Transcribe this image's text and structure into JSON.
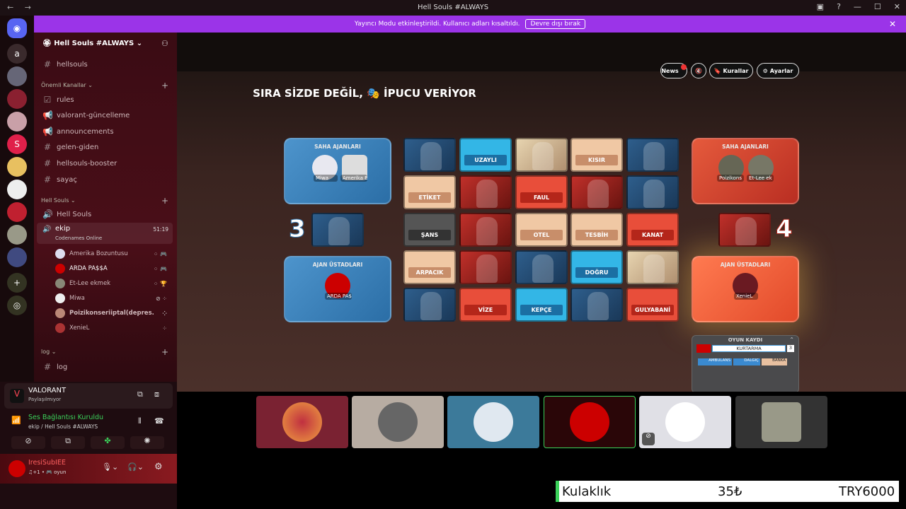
{
  "window": {
    "title": "Hell Souls #ALWAYS",
    "nav": "← →"
  },
  "banner": {
    "text": "Yayıncı Modu etkinleştirildi. Kullanıcı adları kısaltıldı.",
    "button": "Devre dışı bırak",
    "close": "✕"
  },
  "servers": [
    "a"
  ],
  "sidebar": {
    "server_name": "Hell Souls #ALWAYS",
    "top_channel": "hellsouls",
    "categories": [
      {
        "name": "Önemli Kanallar",
        "channels": [
          "rules",
          "valorant-güncelleme",
          "announcements",
          "gelen-giden",
          "hellsouls-booster",
          "sayaç"
        ]
      },
      {
        "name": "Hell Souls",
        "channels": [
          "Hell Souls"
        ]
      },
      {
        "name": "log",
        "channels": [
          "log"
        ]
      }
    ],
    "voice_channel": {
      "name": "ekip",
      "timer": "51:19",
      "activity": "Codenames Online"
    },
    "voice_users": [
      "Amerika Bozuntusu",
      "ARDA PA$$A",
      "Et-Lee ekmek",
      "Miwa",
      "Poizikonseriiptal(depres...",
      "XenieL"
    ]
  },
  "activity": {
    "game": "VALORANT",
    "status": "Paylaşılmıyor"
  },
  "voice": {
    "status": "Ses Bağlantısı Kuruldu",
    "location": "ekip / Hell Souls #ALWAYS"
  },
  "user": {
    "name": "IresiSubIEE",
    "status": "♫+1 • 🎮 oyun"
  },
  "game": {
    "buttons": {
      "news": "News",
      "rules": "Kurallar",
      "settings": "Ayarlar"
    },
    "turn_text": "SIRA SİZDE DEĞİL, 🎭 İPUCU VERİYOR",
    "blue_team": {
      "agents_title": "SAHA AJANLARI",
      "agents": [
        "Miwa",
        "Amerika B"
      ],
      "masters_title": "AJAN ÜSTADLARI",
      "masters": [
        "ARDA PA$"
      ],
      "score": "3"
    },
    "red_team": {
      "agents_title": "SAHA AJANLARI",
      "agents": [
        "Poizikons",
        "Et-Lee ek"
      ],
      "masters_title": "AJAN ÜSTADLARI",
      "masters": [
        "XenieL"
      ],
      "score": "4"
    },
    "board": [
      {
        "word": "",
        "type": "ablue"
      },
      {
        "word": "UZAYLI",
        "type": "blue"
      },
      {
        "word": "",
        "type": "abeige"
      },
      {
        "word": "KISIR",
        "type": "beige"
      },
      {
        "word": "",
        "type": "ablue"
      },
      {
        "word": "ETİKET",
        "type": "beige"
      },
      {
        "word": "",
        "type": "ared"
      },
      {
        "word": "FAUL",
        "type": "red"
      },
      {
        "word": "",
        "type": "ared"
      },
      {
        "word": "",
        "type": "ablue"
      },
      {
        "word": "ŞANS",
        "type": "gray"
      },
      {
        "word": "",
        "type": "ared"
      },
      {
        "word": "OTEL",
        "type": "beige"
      },
      {
        "word": "TESBİH",
        "type": "beige"
      },
      {
        "word": "KANAT",
        "type": "red"
      },
      {
        "word": "ARPACIK",
        "type": "beige"
      },
      {
        "word": "",
        "type": "ared"
      },
      {
        "word": "",
        "type": "ablue"
      },
      {
        "word": "DOĞRU",
        "type": "blue"
      },
      {
        "word": "",
        "type": "abeige"
      },
      {
        "word": "",
        "type": "ablue"
      },
      {
        "word": "VİZE",
        "type": "red"
      },
      {
        "word": "KEPÇE",
        "type": "blue"
      },
      {
        "word": "",
        "type": "ablue"
      },
      {
        "word": "GULYABANİ",
        "type": "red"
      }
    ],
    "log": {
      "title": "OYUN KAYDI",
      "clue": "KURTARMA",
      "clue_count": "3",
      "guesses": [
        "AMBULANS",
        "DALGIÇ",
        "BANKA"
      ]
    }
  },
  "ticker": {
    "item": "Kulaklık",
    "price": "35₺",
    "total": "TRY6000"
  }
}
